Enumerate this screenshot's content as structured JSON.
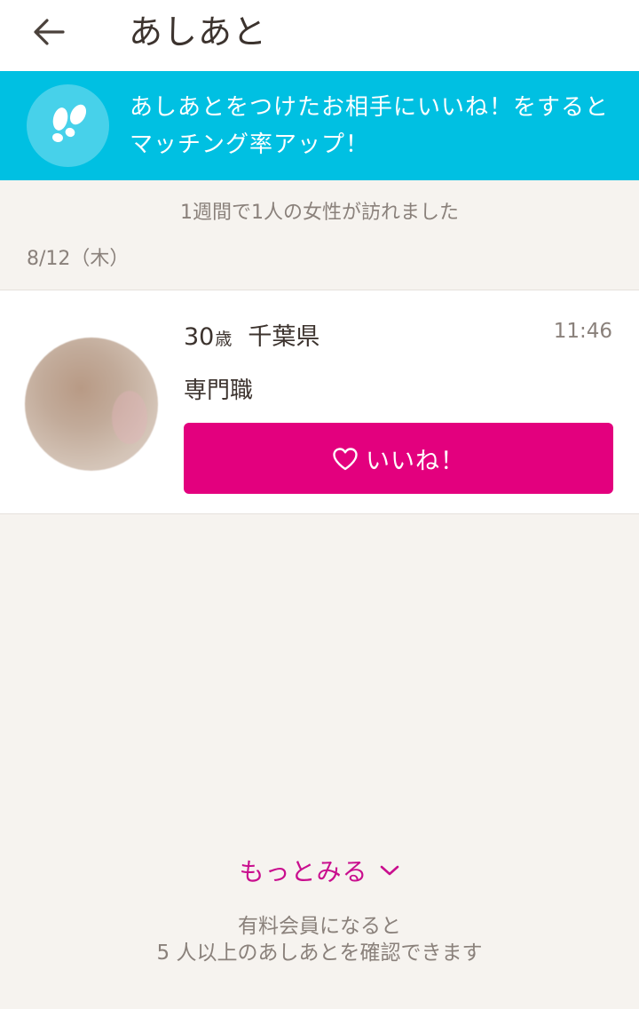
{
  "header": {
    "title": "あしあと",
    "back_icon": "arrow-left-icon"
  },
  "banner": {
    "icon": "footprints-icon",
    "line1": "あしあとをつけたお相手にいいね！をすると",
    "line2": "マッチング率アップ！",
    "background": "#00c0e2"
  },
  "summary": {
    "text": "1週間で1人の女性が訪れました"
  },
  "date_group": {
    "label": "8/12（木）"
  },
  "visitor": {
    "age": "30",
    "age_unit": "歳",
    "prefecture": "千葉県",
    "time": "11:46",
    "occupation": "専門職",
    "like_label": "いいね！",
    "like_icon": "heart-outline-icon",
    "like_color": "#e3007e"
  },
  "more": {
    "label": "もっとみる",
    "icon": "chevron-down-icon",
    "color": "#c90e8e"
  },
  "premium_note": {
    "line1": "有料会員になると",
    "line2": "5 人以上のあしあとを確認できます"
  }
}
